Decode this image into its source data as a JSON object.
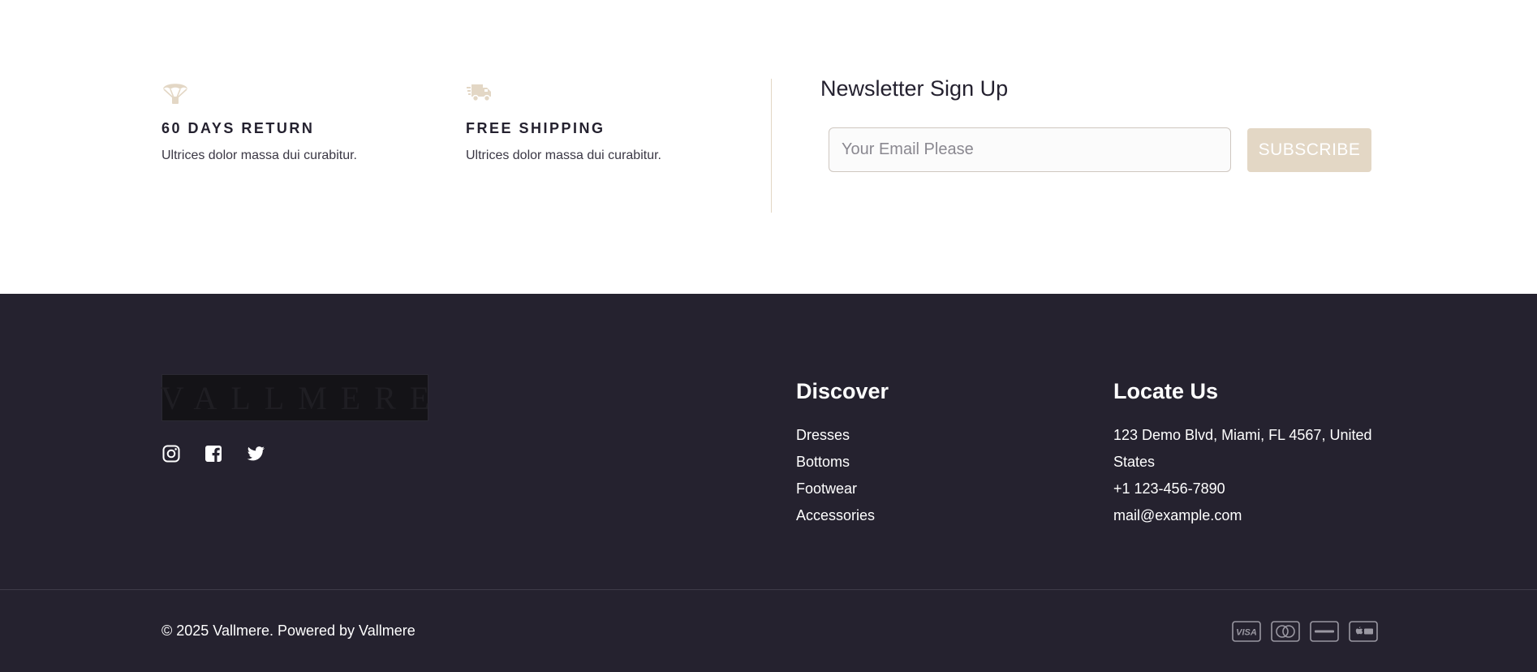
{
  "features": [
    {
      "icon": "parachute-icon",
      "title": "60 DAYS RETURN",
      "description": "Ultrices dolor massa dui curabitur."
    },
    {
      "icon": "delivery-truck-icon",
      "title": "FREE SHIPPING",
      "description": "Ultrices dolor massa dui curabitur."
    }
  ],
  "newsletter": {
    "title": "Newsletter Sign Up",
    "email_placeholder": "Your Email Please",
    "email_value": "",
    "subscribe_label": "SUBSCRIBE"
  },
  "footer": {
    "logo_text": "VALLMERE",
    "social": [
      "instagram-icon",
      "facebook-icon",
      "twitter-icon"
    ],
    "discover": {
      "title": "Discover",
      "links": [
        "Dresses",
        "Bottoms",
        "Footwear",
        "Accessories"
      ]
    },
    "locate": {
      "title": "Locate Us",
      "address": "123 Demo Blvd, Miami, FL 4567, United States",
      "phone": "+1 123-456-7890",
      "email": "mail@example.com"
    },
    "copyright": "© 2025 Vallmere. Powered by Vallmere",
    "payments": [
      "visa-icon",
      "mastercard-icon",
      "discover-icon",
      "apple-pay-icon"
    ]
  },
  "colors": {
    "accent": "#e3d7c5",
    "footer_bg": "#25222f",
    "text_dark": "#24212f",
    "white": "#ffffff"
  }
}
